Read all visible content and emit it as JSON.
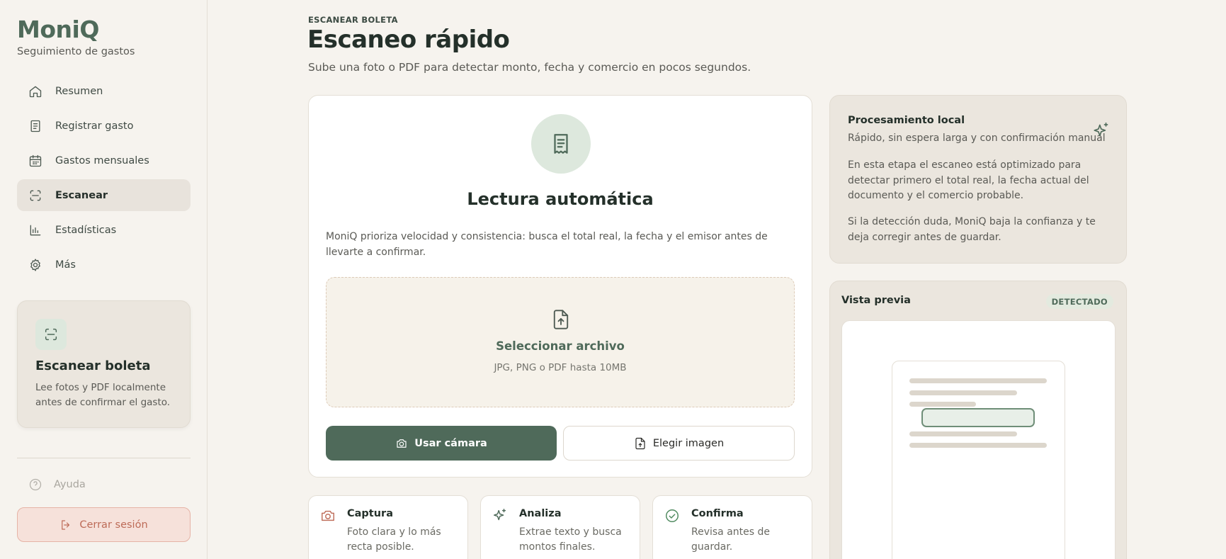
{
  "app": {
    "name": "MoniQ",
    "tagline": "Seguimiento de gastos"
  },
  "sidebar": {
    "items": [
      {
        "label": "Resumen",
        "icon": "home-icon",
        "active": false
      },
      {
        "label": "Registrar gasto",
        "icon": "receipt-icon",
        "active": false
      },
      {
        "label": "Gastos mensuales",
        "icon": "calendar-icon",
        "active": false
      },
      {
        "label": "Escanear",
        "icon": "scan-icon",
        "active": true
      },
      {
        "label": "Estadísticas",
        "icon": "bar-chart-icon",
        "active": false
      },
      {
        "label": "Más",
        "icon": "gear-icon",
        "active": false
      }
    ],
    "promo": {
      "icon": "scan-icon",
      "title": "Escanear boleta",
      "description": "Lee fotos y PDF localmente antes de confirmar el gasto."
    },
    "help_label": "Ayuda",
    "logout_label": "Cerrar sesión"
  },
  "header": {
    "eyebrow": "ESCANEAR BOLETA",
    "title": "Escaneo rápido",
    "subtitle": "Sube una foto o PDF para detectar monto, fecha y comercio en pocos segundos."
  },
  "scan_card": {
    "icon": "document-icon",
    "title": "Lectura automática",
    "description": "MoniQ prioriza velocidad y consistencia: busca el total real, la fecha y el emisor antes de llevarte a confirmar.",
    "dropzone": {
      "icon": "file-upload-icon",
      "title": "Seleccionar archivo",
      "hint": "JPG, PNG o PDF hasta 10MB"
    },
    "camera_button": "Usar cámara",
    "image_button": "Elegir imagen"
  },
  "steps": [
    {
      "icon": "camera-icon",
      "title": "Captura",
      "description": "Foto clara y lo más recta posible.",
      "color": "#c0705d"
    },
    {
      "icon": "sparkle-icon",
      "title": "Analiza",
      "description": "Extrae texto y busca montos finales.",
      "color": "#4f6a5a"
    },
    {
      "icon": "check-circle-icon",
      "title": "Confirma",
      "description": "Revisa antes de guardar.",
      "color": "#4f8a5f"
    }
  ],
  "info": {
    "title": "Procesamiento local",
    "subtitle": "Rápido, sin espera larga y con confirmación manual",
    "paragraph_1": "En esta etapa el escaneo está optimizado para detectar primero el total real, la fecha actual del documento y el comercio probable.",
    "paragraph_2": "Si la detección duda, MoniQ baja la confianza y te deja corregir antes de guardar."
  },
  "preview": {
    "title": "Vista previa",
    "badge": "DETECTADO"
  },
  "colors": {
    "accent": "#4f6a5a",
    "background": "#f6f3ee",
    "danger": "#bd6b57"
  }
}
